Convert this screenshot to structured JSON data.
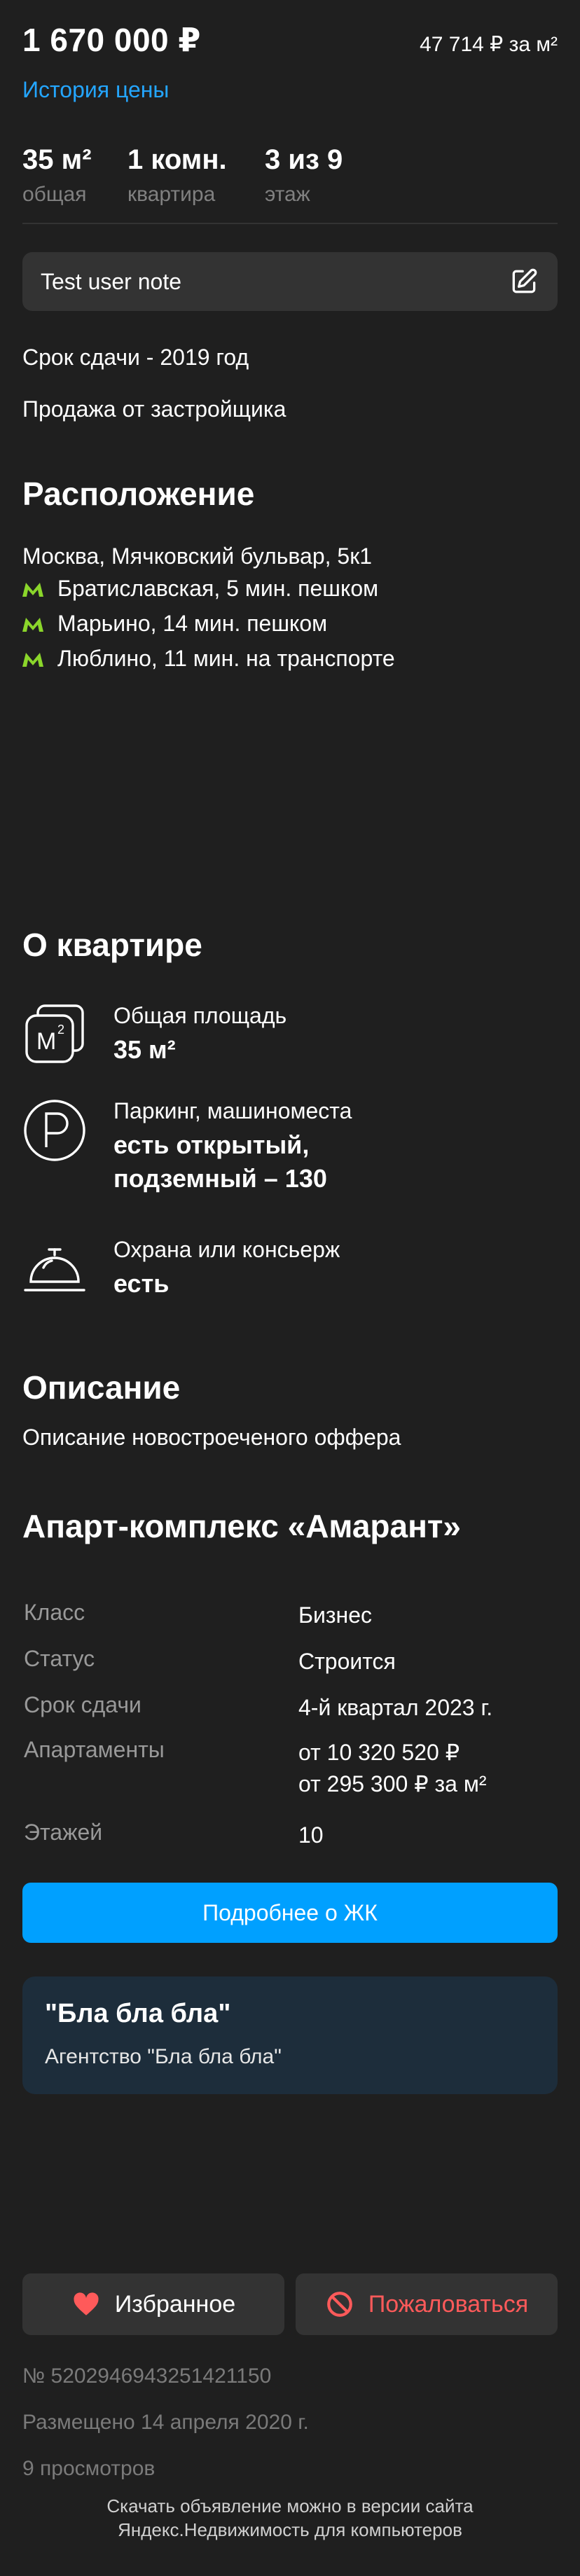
{
  "header": {
    "price": "1 670 000 ₽",
    "price_per_m2": "47 714 ₽ за м²",
    "history_link": "История цены"
  },
  "stats": [
    {
      "value": "35 м²",
      "label": "общая"
    },
    {
      "value": "1 комн.",
      "label": "квартира"
    },
    {
      "value": "3 из 9",
      "label": "этаж"
    }
  ],
  "note": {
    "text": "Test user note",
    "icon": "edit-icon"
  },
  "info": {
    "deadline": "Срок сдачи - 2019 год",
    "sale_type": "Продажа от застройщика"
  },
  "location": {
    "title": "Расположение",
    "address": "Москва, Мячковский бульвар, 5к1",
    "metro": [
      {
        "text": "Братиславская, 5 мин. пешком"
      },
      {
        "text": "Марьино, 14 мин. пешком"
      },
      {
        "text": "Люблино, 11 мин. на транспорте"
      }
    ],
    "metro_color": "#8bd62b"
  },
  "about": {
    "title": "О квартире",
    "features": [
      {
        "icon": "area-icon",
        "caption": "Общая площадь",
        "value": "35 м²"
      },
      {
        "icon": "parking-icon",
        "caption": "Паркинг, машиноместа",
        "value_line1": "есть открытый,",
        "value_line2": "подземный – 130"
      },
      {
        "icon": "concierge-bell-icon",
        "caption": "Охрана или консьерж",
        "value": "есть"
      }
    ]
  },
  "description": {
    "title": "Описание",
    "text": "Описание новостроеченого оффера"
  },
  "complex": {
    "title": "Апарт-комплекс «Амарант»",
    "rows": [
      {
        "key": "Класс",
        "value": "Бизнес"
      },
      {
        "key": "Статус",
        "value": "Строится"
      },
      {
        "key": "Срок сдачи",
        "value": "4-й квартал 2023 г."
      },
      {
        "key": "Апартаменты",
        "value": "от 10 320 520 ₽",
        "value2": "от 295 300 ₽ за м²"
      },
      {
        "key": "Этажей",
        "value": "10"
      }
    ],
    "button": "Подробнее о ЖК"
  },
  "agency": {
    "name": "\"Бла бла бла\"",
    "subtitle": "Агентство \"Бла бла бла\""
  },
  "actions": {
    "favorite": "Избранное",
    "complain": "Пожаловаться",
    "complain_color": "#ff5a5a",
    "heart_color": "#ff5a5a"
  },
  "meta": {
    "id": "№ 5202946943251421150",
    "published": "Размещено 14 апреля 2020 г.",
    "views": "9 просмотров"
  },
  "footer": {
    "line1": "Скачать объявление можно в версии сайта",
    "line2": "Яндекс.Недвижимость для компьютеров"
  }
}
